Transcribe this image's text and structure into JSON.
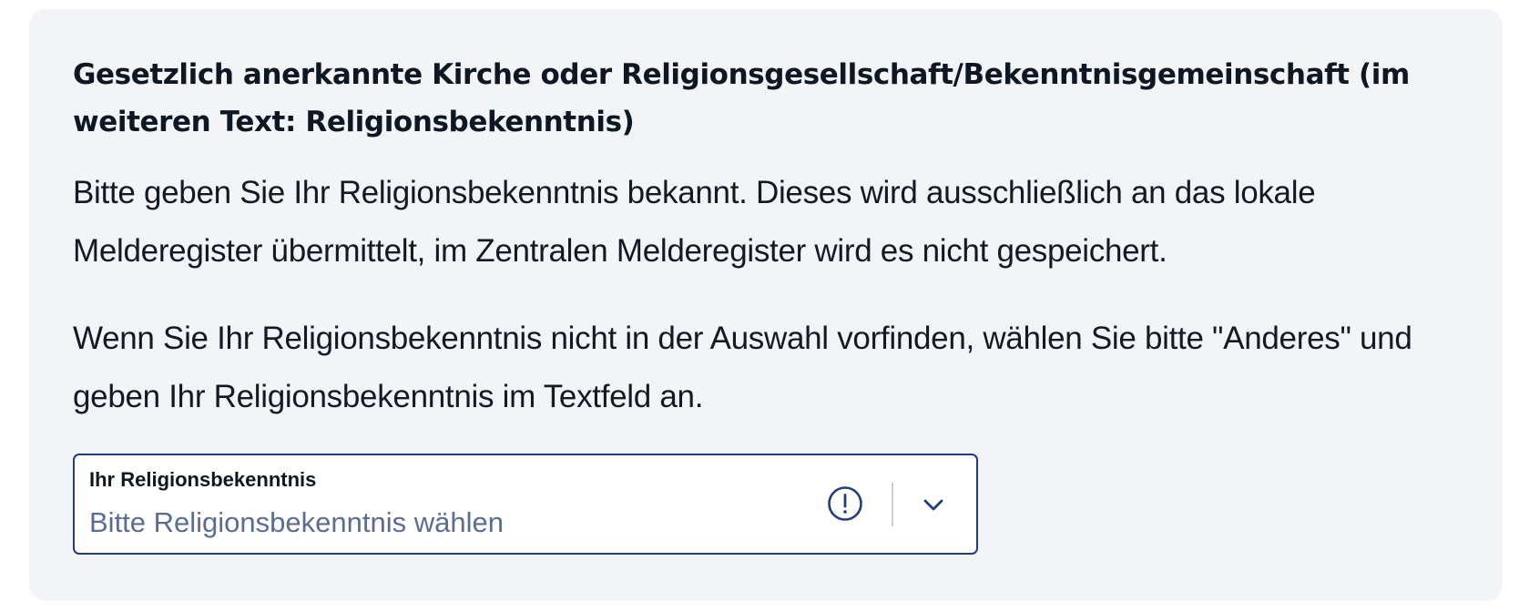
{
  "section": {
    "heading": "Gesetzlich anerkannte Kirche oder Religionsgesellschaft/Bekenntnisgemeinschaft (im weiteren Text: Religionsbekenntnis)",
    "paragraph_1": "Bitte geben Sie Ihr Religionsbekenntnis bekannt. Dieses wird ausschließlich an das lokale Melderegister übermittelt, im Zentralen Melderegister wird es nicht gespeichert.",
    "paragraph_2": "Wenn Sie Ihr Religionsbekenntnis nicht in der Auswahl vorfinden, wählen Sie bitte \"Anderes\" und geben Ihr Religionsbekenntnis im Textfeld an."
  },
  "select": {
    "label": "Ihr Religionsbekenntnis",
    "placeholder": "Bitte Religionsbekenntnis wählen",
    "status_icon": "alert-circle-icon",
    "toggle_icon": "chevron-down-icon"
  },
  "colors": {
    "panel_background": "#f2f4f8",
    "border_accent": "#1f3b82",
    "placeholder_text": "#5b6c93",
    "divider": "#c9ced8"
  }
}
